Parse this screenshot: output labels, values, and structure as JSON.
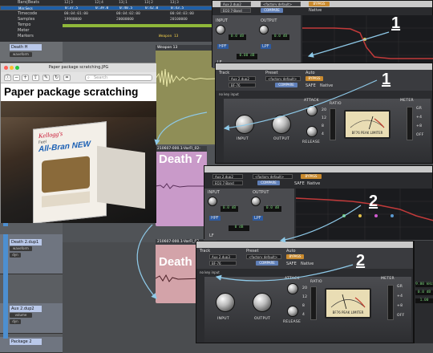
{
  "ruler": {
    "rows": [
      {
        "label": "Bars|Beats",
        "values": [
          "12|3",
          "12|4",
          "13|1",
          "13|2",
          "13|3"
        ]
      },
      {
        "label": "Min:Secs",
        "values": [
          "0:37.5",
          "0:39.0",
          "0:40.5",
          "0:42.0",
          "0:43.5"
        ],
        "selected": true
      },
      {
        "label": "Timecode",
        "values": [
          "00:04:01:00",
          "00:04:02:00",
          "00:04:03:00"
        ]
      },
      {
        "label": "Samples",
        "values": [
          "19980000",
          "20000000",
          "20100000"
        ]
      },
      {
        "label": "Tempo",
        "values": []
      },
      {
        "label": "Meter",
        "values": []
      },
      {
        "label": "Markers",
        "values": []
      }
    ],
    "marker_label": "Weapon 13"
  },
  "tracks": [
    {
      "name": "Death H",
      "sub1": "waveform",
      "sub2": "dyn"
    },
    {
      "name": "Death 2.dup1",
      "sub1": "waveform",
      "sub2": "dyn"
    },
    {
      "name": "Aux 2.dup2",
      "sub1": "volume",
      "sub2": "dyn"
    },
    {
      "name": "Package 2",
      "sub1": "",
      "sub2": ""
    }
  ],
  "clips": {
    "weapon": "Weapon 13",
    "death1_header": "210607-000.1-VarFl_02-",
    "death1_label": "Death 7",
    "death2_header": "210607-000.1-VarFl_02-",
    "death2_label": "Death 7"
  },
  "preview": {
    "window_title": "Paper package scratching.JPG",
    "search_placeholder": "Search",
    "caption": "Paper package scratching",
    "box_brand": "Kellogg's",
    "box_prefix": "Feel",
    "box_product": "All-Bran NEW"
  },
  "plugins": [
    {
      "track_label": "Track",
      "preset_label": "Preset",
      "auto_label": "Auto",
      "track_name": "Aux 2.dup2",
      "track_id": "BF-76",
      "preset_name": "<factory default>",
      "compare": "COMPARE",
      "bypass": "BYPASS",
      "safe": "SAFE",
      "native": "Native",
      "key_input": "no key input",
      "attack": "ATTACK",
      "release": "RELEASE",
      "ratio": "RATIO",
      "meter": "METER",
      "input": "INPUT",
      "output": "OUTPUT",
      "meter_name": "BF76 PEAK LIMITER",
      "ratio_values": [
        "20",
        "12",
        "8",
        "4"
      ],
      "meter_values": [
        "GR",
        "+4",
        "+8",
        "OFF"
      ],
      "knob_scale": [
        "24",
        "30",
        "36",
        "42",
        "48",
        "12",
        "6",
        "0"
      ],
      "annotation": "1"
    },
    {
      "track_label": "Track",
      "preset_label": "Preset",
      "auto_label": "Auto",
      "track_name": "Aux 2.dup3",
      "track_id": "BF-76",
      "preset_name": "<factory default>",
      "compare": "COMPARE",
      "bypass": "BYPASS",
      "safe": "SAFE",
      "native": "Native",
      "key_input": "no key input",
      "attack": "ATTACK",
      "release": "RELEASE",
      "ratio": "RATIO",
      "meter": "METER",
      "input": "INPUT",
      "output": "OUTPUT",
      "meter_name": "BF76 PEAK LIMITER",
      "ratio_values": [
        "20",
        "12",
        "8",
        "4"
      ],
      "meter_values": [
        "GR",
        "+4",
        "+8",
        "OFF"
      ],
      "knob_scale": [
        "24",
        "30",
        "36",
        "42",
        "48",
        "12",
        "6",
        "0"
      ],
      "annotation": "2"
    }
  ],
  "eqs": [
    {
      "track_name": "Aux 2.dup2",
      "eq_name": "EQ3 7-Band",
      "preset_name": "<factory default>",
      "compare": "COMPARE",
      "bypass": "BYPASS",
      "safe": "SAFE",
      "native": "Native",
      "input": "INPUT",
      "output": "OUTPUT",
      "input_val": "0.0 dB",
      "output_val": "0.0 dB",
      "gain_val": "0.00 dB",
      "hpf": "HPF",
      "lpf": "LPF",
      "lf": "LF",
      "annotation": "1"
    },
    {
      "track_name": "Aux 2.dup2",
      "eq_name": "EQ3 7-Band",
      "preset_name": "<factory default>",
      "compare": "COMPARE",
      "bypass": "BYPASS",
      "safe": "SAFE",
      "native": "Native",
      "input": "INPUT",
      "output": "OUTPUT",
      "input_val": "0.0 dB",
      "output_val": "0.0 dB",
      "gain_val": "0 dB",
      "hpf": "HPF",
      "lpf": "LPF",
      "lf": "LF",
      "annotation": "2"
    }
  ],
  "right_edge": {
    "freq": "9.00 kHz",
    "gain": "0.0 dB",
    "q": "1.00"
  }
}
